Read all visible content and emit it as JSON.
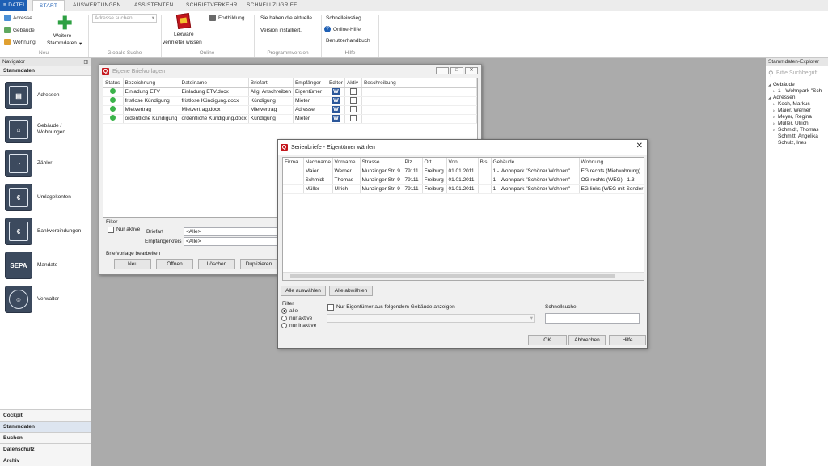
{
  "ribbon_tabs": {
    "file": "≡ DATEI",
    "start": "START",
    "auswertungen": "AUSWERTUNGEN",
    "assistenten": "ASSISTENTEN",
    "schriftverkehr": "SCHRIFTVERKEHR",
    "schnellzugriff": "SCHNELLZUGRIFF"
  },
  "ribbon": {
    "neu": {
      "adresse": "Adresse",
      "gebaeude": "Gebäude",
      "wohnung": "Wohnung",
      "weitere_line1": "Weitere",
      "weitere_line2": "Stammdaten",
      "group": "Neu"
    },
    "suche": {
      "placeholder": "Adresse suchen",
      "group": "Globale Suche"
    },
    "online": {
      "lexware_line1": "Lexware",
      "lexware_line2": "vermieter wissen",
      "fortbildung": "Fortbildung",
      "group": "Online"
    },
    "version": {
      "line1": "Sie haben die aktuelle",
      "line2": "Version installiert.",
      "group": "Programmversion"
    },
    "hilfe": {
      "schnelleinstieg": "Schnelleinstieg",
      "onlinehilfe": "Online-Hilfe",
      "handbuch": "Benutzerhandbuch",
      "group": "Hilfe"
    }
  },
  "navigator": {
    "title": "Navigator",
    "section": "Stammdaten",
    "items": [
      {
        "label": "Adressen"
      },
      {
        "label": "Gebäude / Wohnungen"
      },
      {
        "label": "Zähler"
      },
      {
        "label": "Umlagekonten"
      },
      {
        "label": "Bankverbindungen"
      },
      {
        "label": "Mandate"
      },
      {
        "label": "Verwalter"
      }
    ],
    "bottom": [
      "Cockpit",
      "Stammdaten",
      "Buchen",
      "Datenschutz",
      "Archiv"
    ]
  },
  "explorer": {
    "title": "Stammdaten-Explorer",
    "search_placeholder": "Bitte Suchbegriff",
    "tree": [
      {
        "label": "Gebäude",
        "level": 0,
        "toggle": "◢"
      },
      {
        "label": "1 - Wohnpark \"Sch",
        "level": 1,
        "toggle": "▹"
      },
      {
        "label": "Adressen",
        "level": 0,
        "toggle": "◢"
      },
      {
        "label": "Koch, Markus",
        "level": 1,
        "toggle": "▹"
      },
      {
        "label": "Maier, Werner",
        "level": 1,
        "toggle": "▹"
      },
      {
        "label": "Meyer, Regina",
        "level": 1,
        "toggle": "▹"
      },
      {
        "label": "Müller, Ulrich",
        "level": 1,
        "toggle": "▹"
      },
      {
        "label": "Schmidt, Thomas",
        "level": 1,
        "toggle": "▹"
      },
      {
        "label": "Schmitt, Angelika",
        "level": 1,
        "toggle": ""
      },
      {
        "label": "Schulz, Ines",
        "level": 1,
        "toggle": ""
      }
    ]
  },
  "briefvorlagen": {
    "title": "Eigene Briefvorlagen",
    "columns": [
      "Status",
      "Bezeichnung",
      "Dateiname",
      "Briefart",
      "Empfänger",
      "Editor",
      "Aktiv",
      "Beschreibung"
    ],
    "rows": [
      {
        "bez": "Einladung ETV",
        "datei": "Einladung ETV.docx",
        "art": "Allg. Anschreiben",
        "empf": "Eigentümer"
      },
      {
        "bez": "fristlose Kündigung",
        "datei": "fristlose Kündigung.docx",
        "art": "Kündigung",
        "empf": "Mieter"
      },
      {
        "bez": "Mietvertrag",
        "datei": "Mietvertrag.docx",
        "art": "Mietvertrag",
        "empf": "Adresse"
      },
      {
        "bez": "ordentliche Kündigung",
        "datei": "ordentliche Kündigung.docx",
        "art": "Kündigung",
        "empf": "Mieter"
      }
    ],
    "filter_label": "Filter",
    "nur_aktive": "Nur aktive",
    "briefart_label": "Briefart",
    "briefart_value": "<Alle>",
    "empfaenger_label": "Empfängerkreis",
    "empfaenger_value": "<Alle>",
    "edit_label": "Briefvorlage bearbeiten",
    "buttons": {
      "neu": "Neu",
      "oeffnen": "Öffnen",
      "loeschen": "Löschen",
      "duplizieren": "Duplizieren"
    }
  },
  "serienbriefe": {
    "title": "Serienbriefe - Eigentümer wählen",
    "columns": [
      "Firma",
      "Nachname",
      "Vorname",
      "Strasse",
      "Plz",
      "Ort",
      "Von",
      "Bis",
      "Gebäude",
      "Wohnung"
    ],
    "rows": [
      [
        "",
        "Maier",
        "Werner",
        "Munzinger Str. 9",
        "79111",
        "Freiburg",
        "01.01.2011",
        "",
        "1 - Wohnpark \"Schöner Wohnen\"",
        "EG rechts (Mietwohnung)"
      ],
      [
        "",
        "Schmidt",
        "Thomas",
        "Munzinger Str. 9",
        "79111",
        "Freiburg",
        "01.01.2011",
        "",
        "1 - Wohnpark \"Schöner Wohnen\"",
        "OG rechts (WEG) - 1.3"
      ],
      [
        "",
        "Müller",
        "Ulrich",
        "Munzinger Str. 9",
        "79111",
        "Freiburg",
        "01.01.2011",
        "",
        "1 - Wohnpark \"Schöner Wohnen\"",
        "EG links (WEG mit Sonder"
      ]
    ],
    "alle_auswaehlen": "Alle auswählen",
    "alle_abwaehlen": "Alle abwählen",
    "filter_label": "Filter",
    "radio": [
      "alle",
      "nur aktive",
      "nur inaktive"
    ],
    "gebaeude_check": "Nur Eigentümer aus folgendem Gebäude anzeigen",
    "schnellsuche": "Schnellsuche",
    "ok": "OK",
    "abbrechen": "Abbrechen",
    "hilfe": "Hilfe"
  },
  "colors": {
    "accent": "#1e5fb4",
    "logo_red": "#c4161c",
    "nav_tile": "#3c4a5e",
    "status_green": "#3bb34a",
    "word_blue": "#2b579a"
  }
}
